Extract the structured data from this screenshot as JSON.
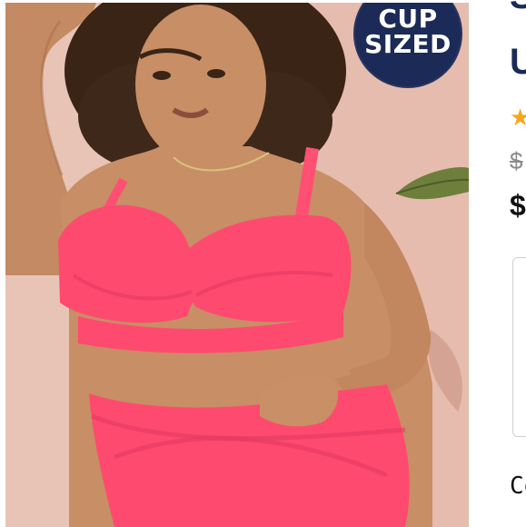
{
  "badge": {
    "line1": "CUP",
    "line2": "SIZED"
  },
  "product": {
    "title_fragment_1": "S",
    "title_fragment_2": "U",
    "rating_icon": "star-icon",
    "old_price_fragment": "$",
    "price_fragment": "$",
    "bottom_text_fragment": "Co"
  },
  "colors": {
    "badge_bg": "#1b2a57",
    "swimsuit": "#ff4a6f",
    "star": "#f3a81c"
  }
}
